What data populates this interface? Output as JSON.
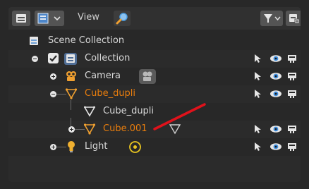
{
  "header": {
    "view_label": "View",
    "icons": [
      "editor-type-icon",
      "display-mode-icon",
      "search-icon",
      "filter-icon",
      "new-collection-icon"
    ]
  },
  "tree": {
    "scene_collection": "Scene Collection",
    "collection": "Collection",
    "camera": "Camera",
    "cube_dupli": "Cube_dupli",
    "cube_dupli_mesh": "Cube_dupli",
    "cube_001": "Cube.001",
    "light": "Light"
  },
  "colors": {
    "background": "#282828",
    "header": "#303030",
    "selected_text": "#e87d0d",
    "eye_icon": "#4b9ee8",
    "annotation_stroke": "#e0121b"
  }
}
